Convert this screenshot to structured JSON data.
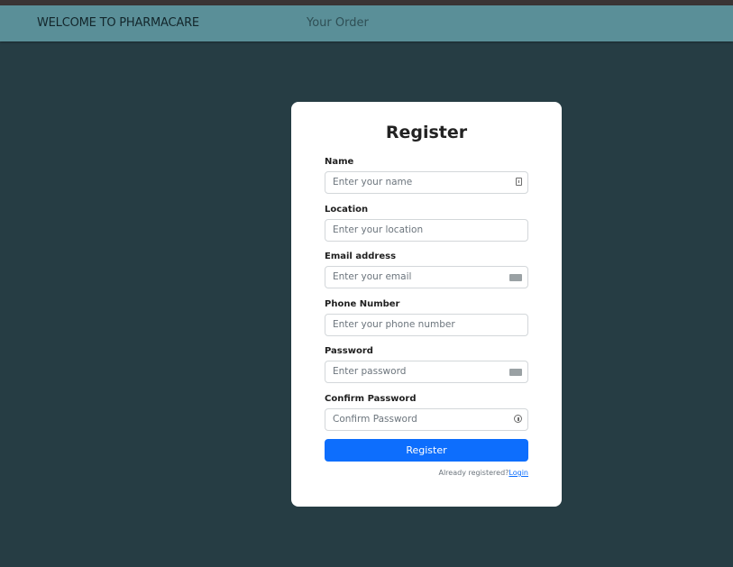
{
  "nav": {
    "brand": "WELCOME TO PHARMACARE",
    "link": "Your Order"
  },
  "form": {
    "title": "Register",
    "fields": [
      {
        "label": "Name",
        "placeholder": "Enter your name",
        "icon": "id-card-icon"
      },
      {
        "label": "Location",
        "placeholder": "Enter your location",
        "icon": ""
      },
      {
        "label": "Email address",
        "placeholder": "Enter your email",
        "icon": "credit-card-icon"
      },
      {
        "label": "Phone Number",
        "placeholder": "Enter your phone number",
        "icon": ""
      },
      {
        "label": "Password",
        "placeholder": "Enter password",
        "icon": "credit-card-icon"
      },
      {
        "label": "Confirm Password",
        "placeholder": "Confirm Password",
        "icon": "key-icon"
      }
    ],
    "submit": "Register",
    "footer_text": "Already registered?",
    "footer_link": "Login"
  },
  "colors": {
    "background": "#263d44",
    "navbar": "#5a8f98",
    "primary": "#0d6efd"
  }
}
